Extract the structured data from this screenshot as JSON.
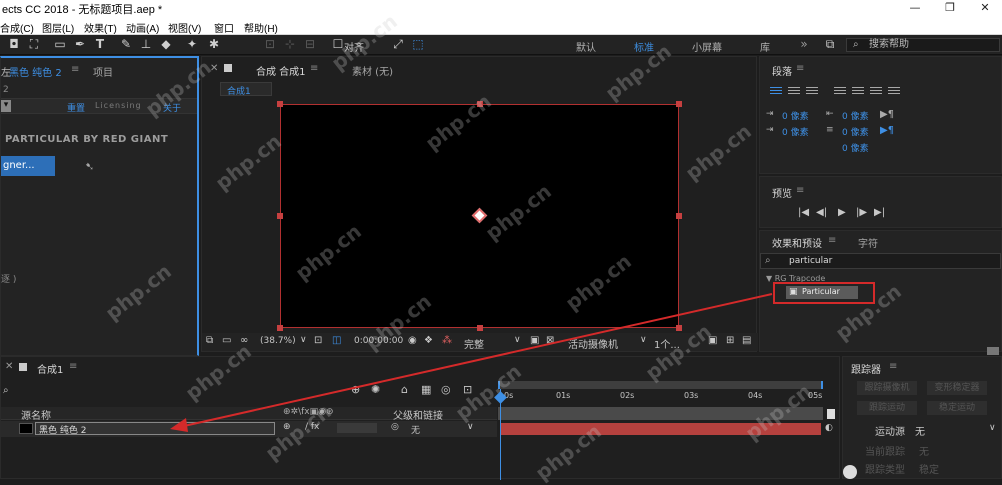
{
  "window": {
    "title": "ects CC 2018 - 无标题项目.aep *",
    "controls": [
      "—",
      "❐",
      "✕"
    ]
  },
  "menu": [
    "合成(C)",
    "图层(L)",
    "效果(T)",
    "动画(A)",
    "视图(V)",
    "窗口",
    "帮助(H)"
  ],
  "toolbar": {
    "snap_label": "对齐",
    "workspaces": [
      "默认",
      "标准",
      "小屏幕",
      "库"
    ],
    "active_workspace": "标准",
    "help_search": "搜索帮助"
  },
  "left_panel": {
    "tab_effect": "黑色 纯色 2",
    "tab_effect_prefix": "左",
    "tab_project": "项目",
    "breadcrumb": "2",
    "reset": "重置",
    "licensing": "Licensing",
    "about": "关于",
    "plugin_title": "PARTICULAR BY RED GIANT",
    "designer_button": "gner...",
    "bottom_text": "逐 )"
  },
  "comp_panel": {
    "tab": "合成 合成1",
    "footage_tab": "素材 (无)",
    "comp_name_chip": "合成1",
    "zoom": "(38.7%)",
    "timecode": "0:00:00:00",
    "quality": "完整",
    "camera": "活动摄像机",
    "views": "1个..."
  },
  "paragraph_panel": {
    "title": "段落",
    "indent_values": [
      "0 像素",
      "0 像素",
      "0 像素",
      "0 像素",
      "0 像素"
    ]
  },
  "preview_panel": {
    "title": "预览",
    "controls": [
      "|◀",
      "◀|",
      "▶",
      "|▶",
      "▶|"
    ]
  },
  "effects_panel": {
    "title": "效果和预设",
    "tab_char": "字符",
    "search_value": "particular",
    "group": "▼ RG Trapcode",
    "item": "Particular"
  },
  "timeline": {
    "tab": "合成1",
    "col_source": "源名称",
    "col_parent": "父级和链接",
    "layer_name": "黑色 纯色 2",
    "parent_value": "无",
    "ruler": [
      "0s",
      "01s",
      "02s",
      "03s",
      "04s",
      "05s"
    ]
  },
  "tracker": {
    "title": "跟踪器",
    "buttons": [
      "跟踪摄像机",
      "变形稳定器",
      "跟踪运动",
      "稳定运动"
    ],
    "source_label": "运动源",
    "source_value": "无",
    "current_track_label": "当前跟踪",
    "current_track_value": "无",
    "track_type_label": "跟踪类型",
    "track_type_value": "稳定"
  },
  "watermark": "php.cn",
  "colors": {
    "accent": "#3e8fe4",
    "arrow": "#d42a2a",
    "layer_bar": "#b5413e",
    "bg": "#1d1d1d"
  }
}
